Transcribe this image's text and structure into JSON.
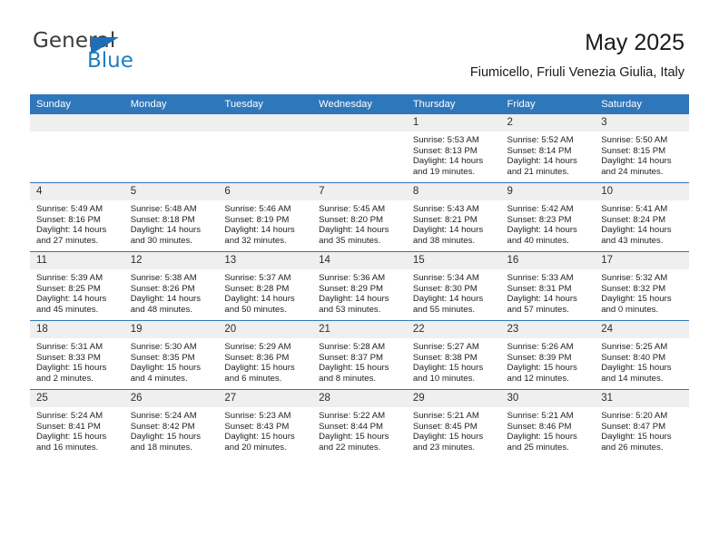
{
  "brand": {
    "name_top": "General",
    "name_bottom": "Blue",
    "accent_color": "#1d7ec4",
    "triangle_color": "#1d6fb8"
  },
  "header": {
    "title": "May 2025",
    "subtitle": "Fiumicello, Friuli Venezia Giulia, Italy"
  },
  "calendar": {
    "header_bg": "#2f77bb",
    "daynum_bg": "#efefef",
    "weekday_headers": [
      "Sunday",
      "Monday",
      "Tuesday",
      "Wednesday",
      "Thursday",
      "Friday",
      "Saturday"
    ],
    "weeks": [
      [
        {
          "day": "",
          "sunrise": "",
          "sunset": "",
          "daylight": "",
          "empty": true
        },
        {
          "day": "",
          "sunrise": "",
          "sunset": "",
          "daylight": "",
          "empty": true
        },
        {
          "day": "",
          "sunrise": "",
          "sunset": "",
          "daylight": "",
          "empty": true
        },
        {
          "day": "",
          "sunrise": "",
          "sunset": "",
          "daylight": "",
          "empty": true
        },
        {
          "day": "1",
          "sunrise": "Sunrise: 5:53 AM",
          "sunset": "Sunset: 8:13 PM",
          "daylight": "Daylight: 14 hours and 19 minutes."
        },
        {
          "day": "2",
          "sunrise": "Sunrise: 5:52 AM",
          "sunset": "Sunset: 8:14 PM",
          "daylight": "Daylight: 14 hours and 21 minutes."
        },
        {
          "day": "3",
          "sunrise": "Sunrise: 5:50 AM",
          "sunset": "Sunset: 8:15 PM",
          "daylight": "Daylight: 14 hours and 24 minutes."
        }
      ],
      [
        {
          "day": "4",
          "sunrise": "Sunrise: 5:49 AM",
          "sunset": "Sunset: 8:16 PM",
          "daylight": "Daylight: 14 hours and 27 minutes."
        },
        {
          "day": "5",
          "sunrise": "Sunrise: 5:48 AM",
          "sunset": "Sunset: 8:18 PM",
          "daylight": "Daylight: 14 hours and 30 minutes."
        },
        {
          "day": "6",
          "sunrise": "Sunrise: 5:46 AM",
          "sunset": "Sunset: 8:19 PM",
          "daylight": "Daylight: 14 hours and 32 minutes."
        },
        {
          "day": "7",
          "sunrise": "Sunrise: 5:45 AM",
          "sunset": "Sunset: 8:20 PM",
          "daylight": "Daylight: 14 hours and 35 minutes."
        },
        {
          "day": "8",
          "sunrise": "Sunrise: 5:43 AM",
          "sunset": "Sunset: 8:21 PM",
          "daylight": "Daylight: 14 hours and 38 minutes."
        },
        {
          "day": "9",
          "sunrise": "Sunrise: 5:42 AM",
          "sunset": "Sunset: 8:23 PM",
          "daylight": "Daylight: 14 hours and 40 minutes."
        },
        {
          "day": "10",
          "sunrise": "Sunrise: 5:41 AM",
          "sunset": "Sunset: 8:24 PM",
          "daylight": "Daylight: 14 hours and 43 minutes."
        }
      ],
      [
        {
          "day": "11",
          "sunrise": "Sunrise: 5:39 AM",
          "sunset": "Sunset: 8:25 PM",
          "daylight": "Daylight: 14 hours and 45 minutes."
        },
        {
          "day": "12",
          "sunrise": "Sunrise: 5:38 AM",
          "sunset": "Sunset: 8:26 PM",
          "daylight": "Daylight: 14 hours and 48 minutes."
        },
        {
          "day": "13",
          "sunrise": "Sunrise: 5:37 AM",
          "sunset": "Sunset: 8:28 PM",
          "daylight": "Daylight: 14 hours and 50 minutes."
        },
        {
          "day": "14",
          "sunrise": "Sunrise: 5:36 AM",
          "sunset": "Sunset: 8:29 PM",
          "daylight": "Daylight: 14 hours and 53 minutes."
        },
        {
          "day": "15",
          "sunrise": "Sunrise: 5:34 AM",
          "sunset": "Sunset: 8:30 PM",
          "daylight": "Daylight: 14 hours and 55 minutes."
        },
        {
          "day": "16",
          "sunrise": "Sunrise: 5:33 AM",
          "sunset": "Sunset: 8:31 PM",
          "daylight": "Daylight: 14 hours and 57 minutes."
        },
        {
          "day": "17",
          "sunrise": "Sunrise: 5:32 AM",
          "sunset": "Sunset: 8:32 PM",
          "daylight": "Daylight: 15 hours and 0 minutes."
        }
      ],
      [
        {
          "day": "18",
          "sunrise": "Sunrise: 5:31 AM",
          "sunset": "Sunset: 8:33 PM",
          "daylight": "Daylight: 15 hours and 2 minutes."
        },
        {
          "day": "19",
          "sunrise": "Sunrise: 5:30 AM",
          "sunset": "Sunset: 8:35 PM",
          "daylight": "Daylight: 15 hours and 4 minutes."
        },
        {
          "day": "20",
          "sunrise": "Sunrise: 5:29 AM",
          "sunset": "Sunset: 8:36 PM",
          "daylight": "Daylight: 15 hours and 6 minutes."
        },
        {
          "day": "21",
          "sunrise": "Sunrise: 5:28 AM",
          "sunset": "Sunset: 8:37 PM",
          "daylight": "Daylight: 15 hours and 8 minutes."
        },
        {
          "day": "22",
          "sunrise": "Sunrise: 5:27 AM",
          "sunset": "Sunset: 8:38 PM",
          "daylight": "Daylight: 15 hours and 10 minutes."
        },
        {
          "day": "23",
          "sunrise": "Sunrise: 5:26 AM",
          "sunset": "Sunset: 8:39 PM",
          "daylight": "Daylight: 15 hours and 12 minutes."
        },
        {
          "day": "24",
          "sunrise": "Sunrise: 5:25 AM",
          "sunset": "Sunset: 8:40 PM",
          "daylight": "Daylight: 15 hours and 14 minutes."
        }
      ],
      [
        {
          "day": "25",
          "sunrise": "Sunrise: 5:24 AM",
          "sunset": "Sunset: 8:41 PM",
          "daylight": "Daylight: 15 hours and 16 minutes."
        },
        {
          "day": "26",
          "sunrise": "Sunrise: 5:24 AM",
          "sunset": "Sunset: 8:42 PM",
          "daylight": "Daylight: 15 hours and 18 minutes."
        },
        {
          "day": "27",
          "sunrise": "Sunrise: 5:23 AM",
          "sunset": "Sunset: 8:43 PM",
          "daylight": "Daylight: 15 hours and 20 minutes."
        },
        {
          "day": "28",
          "sunrise": "Sunrise: 5:22 AM",
          "sunset": "Sunset: 8:44 PM",
          "daylight": "Daylight: 15 hours and 22 minutes."
        },
        {
          "day": "29",
          "sunrise": "Sunrise: 5:21 AM",
          "sunset": "Sunset: 8:45 PM",
          "daylight": "Daylight: 15 hours and 23 minutes."
        },
        {
          "day": "30",
          "sunrise": "Sunrise: 5:21 AM",
          "sunset": "Sunset: 8:46 PM",
          "daylight": "Daylight: 15 hours and 25 minutes."
        },
        {
          "day": "31",
          "sunrise": "Sunrise: 5:20 AM",
          "sunset": "Sunset: 8:47 PM",
          "daylight": "Daylight: 15 hours and 26 minutes."
        }
      ]
    ]
  }
}
